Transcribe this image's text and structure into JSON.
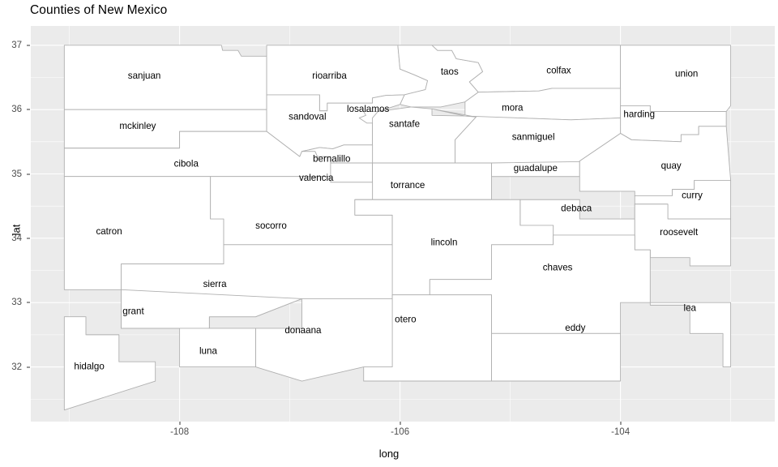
{
  "title": "Counties of New Mexico",
  "axes": {
    "x_label": "long",
    "y_label": "lat",
    "x_ticks": [
      "-108",
      "-106",
      "-104"
    ],
    "x_tick_values": [
      -108,
      -106,
      -104
    ],
    "y_ticks": [
      "32",
      "33",
      "34",
      "35",
      "36",
      "37"
    ],
    "y_tick_values": [
      32,
      33,
      34,
      35,
      36,
      37
    ]
  },
  "theme": {
    "panel_background": "#EBEBEB",
    "grid_color": "#FFFFFF",
    "polygon_fill": "#FFFFFF",
    "polygon_stroke": "#B0B0B0",
    "text_color": "#000000",
    "axis_text_color": "#4D4D4D"
  },
  "chart_data": {
    "type": "map",
    "title": "Counties of New Mexico",
    "xlabel": "long",
    "ylabel": "lat",
    "xlim": [
      -109.35,
      -102.6
    ],
    "ylim": [
      31.15,
      37.3
    ],
    "grid": true,
    "legend": "none",
    "regions": [
      {
        "name": "sanjuan",
        "label_long": -108.32,
        "label_lat": 36.52
      },
      {
        "name": "rioarriba",
        "label_long": -106.64,
        "label_lat": 36.52
      },
      {
        "name": "taos",
        "label_long": -105.55,
        "label_lat": 36.58
      },
      {
        "name": "colfax",
        "label_long": -104.56,
        "label_lat": 36.6
      },
      {
        "name": "union",
        "label_long": -103.4,
        "label_lat": 36.55
      },
      {
        "name": "mora",
        "label_long": -104.98,
        "label_lat": 36.02
      },
      {
        "name": "harding",
        "label_long": -103.83,
        "label_lat": 35.92
      },
      {
        "name": "mckinley",
        "label_long": -108.38,
        "label_lat": 35.74
      },
      {
        "name": "sandoval",
        "label_long": -106.84,
        "label_lat": 35.88
      },
      {
        "name": "losalamos",
        "label_long": -106.29,
        "label_lat": 36.0
      },
      {
        "name": "santafe",
        "label_long": -105.96,
        "label_lat": 35.77
      },
      {
        "name": "sanmiguel",
        "label_long": -104.79,
        "label_lat": 35.57
      },
      {
        "name": "cibola",
        "label_long": -107.94,
        "label_lat": 35.15
      },
      {
        "name": "bernalillo",
        "label_long": -106.62,
        "label_lat": 35.23
      },
      {
        "name": "guadalupe",
        "label_long": -104.77,
        "label_lat": 35.08
      },
      {
        "name": "quay",
        "label_long": -103.54,
        "label_lat": 35.12
      },
      {
        "name": "valencia",
        "label_long": -106.76,
        "label_lat": 34.93
      },
      {
        "name": "torrance",
        "label_long": -105.93,
        "label_lat": 34.82
      },
      {
        "name": "curry",
        "label_long": -103.35,
        "label_lat": 34.66
      },
      {
        "name": "debaca",
        "label_long": -104.4,
        "label_lat": 34.46
      },
      {
        "name": "catron",
        "label_long": -108.64,
        "label_lat": 34.1
      },
      {
        "name": "socorro",
        "label_long": -107.17,
        "label_lat": 34.19
      },
      {
        "name": "roosevelt",
        "label_long": -103.47,
        "label_lat": 34.09
      },
      {
        "name": "lincoln",
        "label_long": -105.6,
        "label_lat": 33.93
      },
      {
        "name": "chaves",
        "label_long": -104.57,
        "label_lat": 33.54
      },
      {
        "name": "sierra",
        "label_long": -107.68,
        "label_lat": 33.28
      },
      {
        "name": "lea",
        "label_long": -103.37,
        "label_lat": 32.91
      },
      {
        "name": "grant",
        "label_long": -108.42,
        "label_lat": 32.86
      },
      {
        "name": "eddy",
        "label_long": -104.41,
        "label_lat": 32.6
      },
      {
        "name": "otero",
        "label_long": -105.95,
        "label_lat": 32.73
      },
      {
        "name": "donaana",
        "label_long": -106.88,
        "label_lat": 32.56
      },
      {
        "name": "luna",
        "label_long": -107.74,
        "label_lat": 32.24
      },
      {
        "name": "hidalgo",
        "label_long": -108.82,
        "label_lat": 32.0
      }
    ]
  }
}
